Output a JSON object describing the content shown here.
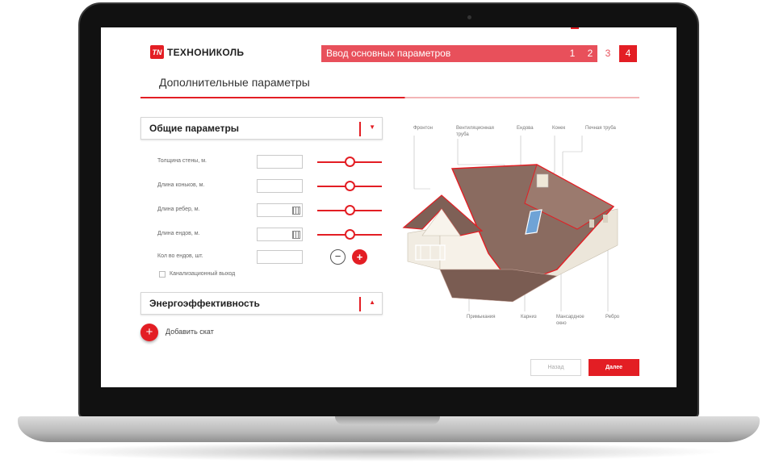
{
  "app": {
    "brand": "ТЕХНОНИКОЛЬ",
    "brand_mark": "TN"
  },
  "stepper": {
    "current_label": "Ввод основных параметров",
    "steps": [
      "1",
      "2",
      "3",
      "4"
    ]
  },
  "page": {
    "title": "Дополнительные параметры"
  },
  "sections": {
    "general": {
      "label": "Общие параметры",
      "arrow": "▼"
    },
    "energy": {
      "label": "Энергоэффективность",
      "arrow": "▲"
    }
  },
  "params": [
    {
      "label": "Толщина стены, м.",
      "value": ""
    },
    {
      "label": "Длина коньков, м.",
      "value": ""
    },
    {
      "label": "Длина ребер, м.",
      "value": ""
    },
    {
      "label": "Длина ендов, м.",
      "value": ""
    },
    {
      "label": "Кол во ендов, шт.",
      "value": ""
    }
  ],
  "stepper_controls": {
    "minus": "−",
    "plus": "+"
  },
  "checkbox": {
    "label": "Канализационный выход",
    "checked": false
  },
  "add_slope": {
    "icon": "+",
    "label": "Добавить скат"
  },
  "actions": {
    "back": "Назад",
    "next": "Далее"
  },
  "house_labels": {
    "fronton": "Фронтон",
    "vent_pipe_1": "Вентиляционная",
    "vent_pipe_2": "труба",
    "endova": "Ендова",
    "konek": "Конек",
    "chimney": "Печная труба",
    "abutment": "Примыкания",
    "eave": "Карниз",
    "window_1": "Мансардное",
    "window_2": "окно",
    "rib": "Ребро"
  },
  "colors": {
    "accent": "#e31e24",
    "accent_light": "#e8505b"
  }
}
